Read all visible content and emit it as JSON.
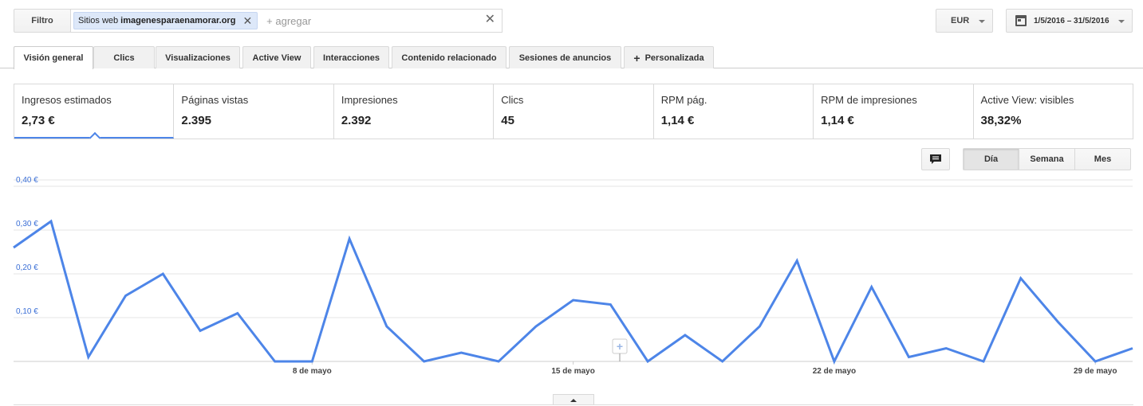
{
  "filter": {
    "label": "Filtro",
    "chip_key": "Sitios web",
    "chip_value": "imagenesparaenamorar.org",
    "add_placeholder": "+ agregar"
  },
  "currency": "EUR",
  "date_range": "1/5/2016 – 31/5/2016",
  "tabs": [
    {
      "label": "Visión general"
    },
    {
      "label": "Clics"
    },
    {
      "label": "Visualizaciones"
    },
    {
      "label": "Active View"
    },
    {
      "label": "Interacciones"
    },
    {
      "label": "Contenido relacionado"
    },
    {
      "label": "Sesiones de anuncios"
    },
    {
      "label": "Personalizada"
    }
  ],
  "scorecards": [
    {
      "label": "Ingresos estimados",
      "value": "2,73 €"
    },
    {
      "label": "Páginas vistas",
      "value": "2.395"
    },
    {
      "label": "Impresiones",
      "value": "2.392"
    },
    {
      "label": "Clics",
      "value": "45"
    },
    {
      "label": "RPM pág.",
      "value": "1,14 €"
    },
    {
      "label": "RPM de impresiones",
      "value": "1,14 €"
    },
    {
      "label": "Active View: visibles",
      "value": "38,32%"
    }
  ],
  "granularity": [
    "Día",
    "Semana",
    "Mes"
  ],
  "colors": {
    "accent": "#4d85e8",
    "axis_label": "#3b6fd6"
  },
  "chart_data": {
    "type": "line",
    "x": [
      "1/5",
      "2/5",
      "3/5",
      "4/5",
      "5/5",
      "6/5",
      "7/5",
      "8/5",
      "9/5",
      "10/5",
      "11/5",
      "12/5",
      "13/5",
      "14/5",
      "15/5",
      "16/5",
      "17/5",
      "18/5",
      "19/5",
      "20/5",
      "21/5",
      "22/5",
      "23/5",
      "24/5",
      "25/5",
      "26/5",
      "27/5",
      "28/5",
      "29/5",
      "30/5",
      "31/5"
    ],
    "values": [
      0.32,
      0.01,
      0.15,
      0.2,
      0.07,
      0.11,
      0.0,
      0.0,
      0.28,
      0.08,
      0.0,
      0.02,
      0.0,
      0.08,
      0.14,
      0.13,
      0.0,
      0.06,
      0.0,
      0.08,
      0.23,
      0.0,
      0.17,
      0.01,
      0.03,
      0.0,
      0.19,
      0.09,
      0.0,
      0.03
    ],
    "y_ticks": [
      "0,10 €",
      "0,20 €",
      "0,30 €",
      "0,40 €"
    ],
    "y_tick_values": [
      0.1,
      0.2,
      0.3,
      0.4
    ],
    "x_ticks": [
      {
        "label": "8 de mayo",
        "index": 7
      },
      {
        "label": "15 de mayo",
        "index": 14
      },
      {
        "label": "22 de mayo",
        "index": 21
      },
      {
        "label": "29 de mayo",
        "index": 28
      }
    ],
    "ylim": [
      0,
      0.4
    ],
    "grid": true
  }
}
